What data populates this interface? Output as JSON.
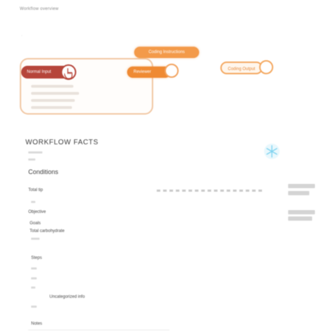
{
  "header": {
    "breadcrumb": "Workflow overview"
  },
  "feature": {
    "pill_label": "Normal Input",
    "lines": [
      "",
      "",
      "",
      ""
    ]
  },
  "pills": {
    "top": "Coding Instructions",
    "mid": "Reviewer",
    "right": "Coding Output"
  },
  "section": {
    "title": "WORKFLOW FACTS",
    "subheading": "Conditions"
  },
  "rows": {
    "row1_label": "Total tip",
    "row2_label": "Objective",
    "row3_label": "Goals",
    "row4_label": "Total carbohydrate",
    "row5_label": "Steps",
    "row6_label": "Uncategorized info",
    "row7_label": "Notes"
  },
  "colors": {
    "accent_orange": "#f39a4a",
    "accent_red": "#b6453a",
    "card_border": "#f1c7a3",
    "badge_blue": "#7fd3f0"
  },
  "icons": {
    "hand": "hand-pointer-icon",
    "badge": "snowflake-badge-icon"
  }
}
